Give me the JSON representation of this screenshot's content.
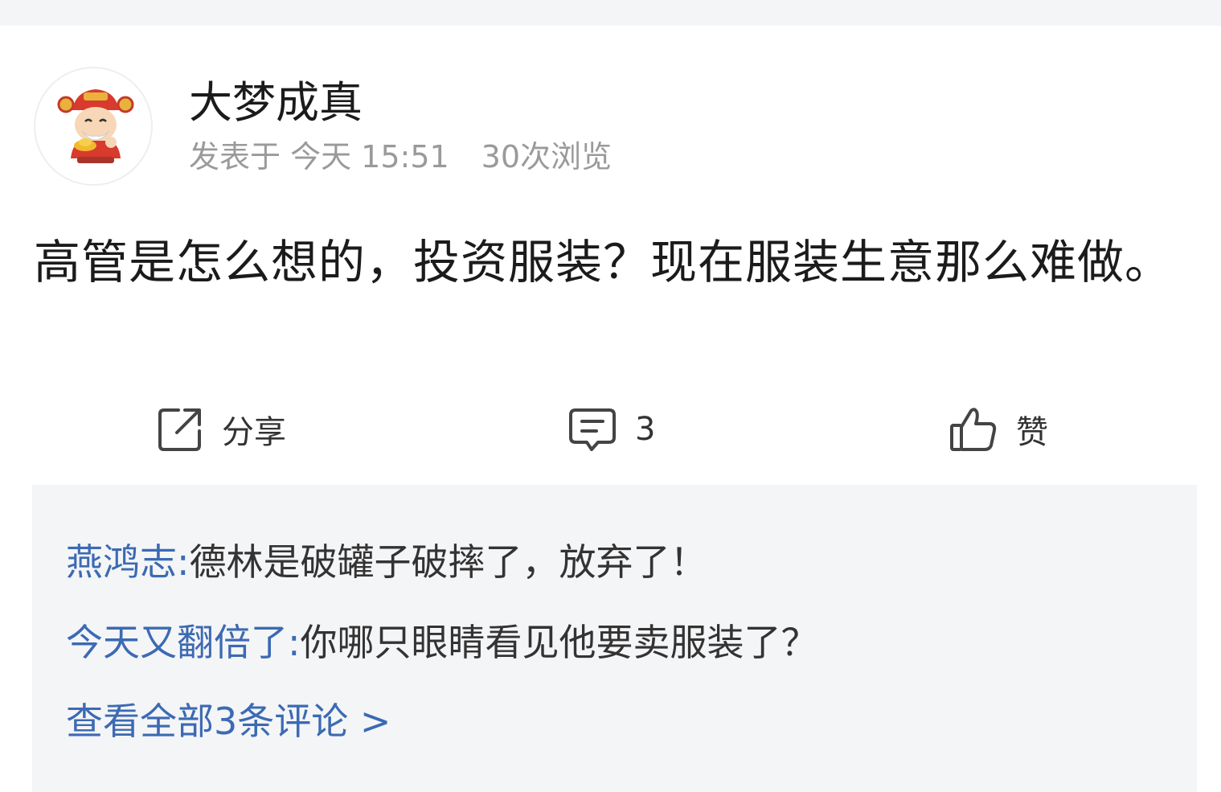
{
  "post": {
    "author": "大梦成真",
    "posted_label": "发表于 今天 15:51",
    "views_label": "30次浏览",
    "content": "高管是怎么想的，投资服装？现在服装生意那么难做。"
  },
  "actions": {
    "share_label": "分享",
    "comment_count": "3",
    "like_label": "赞"
  },
  "comments": [
    {
      "author": "燕鸿志:",
      "text": "德林是破罐子破摔了，放弃了！"
    },
    {
      "author": "今天又翻倍了:",
      "text": "你哪只眼睛看见他要卖服装了？"
    }
  ],
  "view_all_label": "查看全部3条评论 >",
  "colors": {
    "link_blue": "#3c6ab3",
    "meta_gray": "#9a9a9a",
    "panel_bg": "#f4f5f7"
  },
  "icons": {
    "avatar": "god-of-wealth-avatar",
    "share": "share-external-icon",
    "comment": "comment-bubble-icon",
    "like": "thumbs-up-icon"
  }
}
